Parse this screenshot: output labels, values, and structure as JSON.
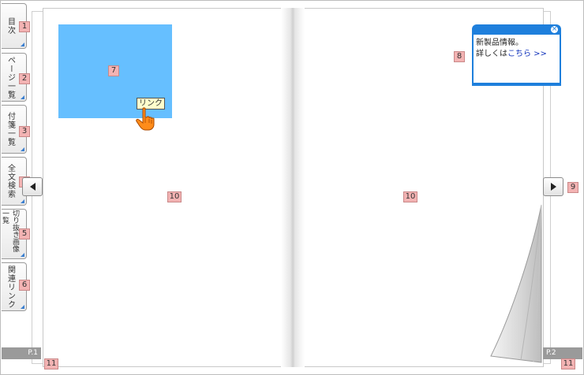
{
  "tabs": [
    {
      "label": "目次",
      "num": "1"
    },
    {
      "label": "ページ一覧",
      "num": "2"
    },
    {
      "label": "付箋一覧",
      "num": "3"
    },
    {
      "label": "全文検索",
      "num": "4"
    },
    {
      "label": "切り抜き画像一覧",
      "num": "5"
    },
    {
      "label": "関連リンク",
      "num": "6"
    }
  ],
  "callouts": {
    "link_area": "7",
    "popup": "8",
    "next": "9",
    "page_left": "10",
    "page_right": "10",
    "pagenum_left": "11",
    "pagenum_right": "11"
  },
  "link_tooltip": "リンク",
  "popup": {
    "line1": "新製品情報。",
    "line2_prefix": "詳しくは",
    "link_text": "こちら >>",
    "close_icon": "×"
  },
  "pages": {
    "left_label": "P.1",
    "right_label": "P.2"
  },
  "colors": {
    "link_area": "#66bfff",
    "popup_border": "#1e7fdc",
    "callout_bg": "#f3b3b3"
  }
}
